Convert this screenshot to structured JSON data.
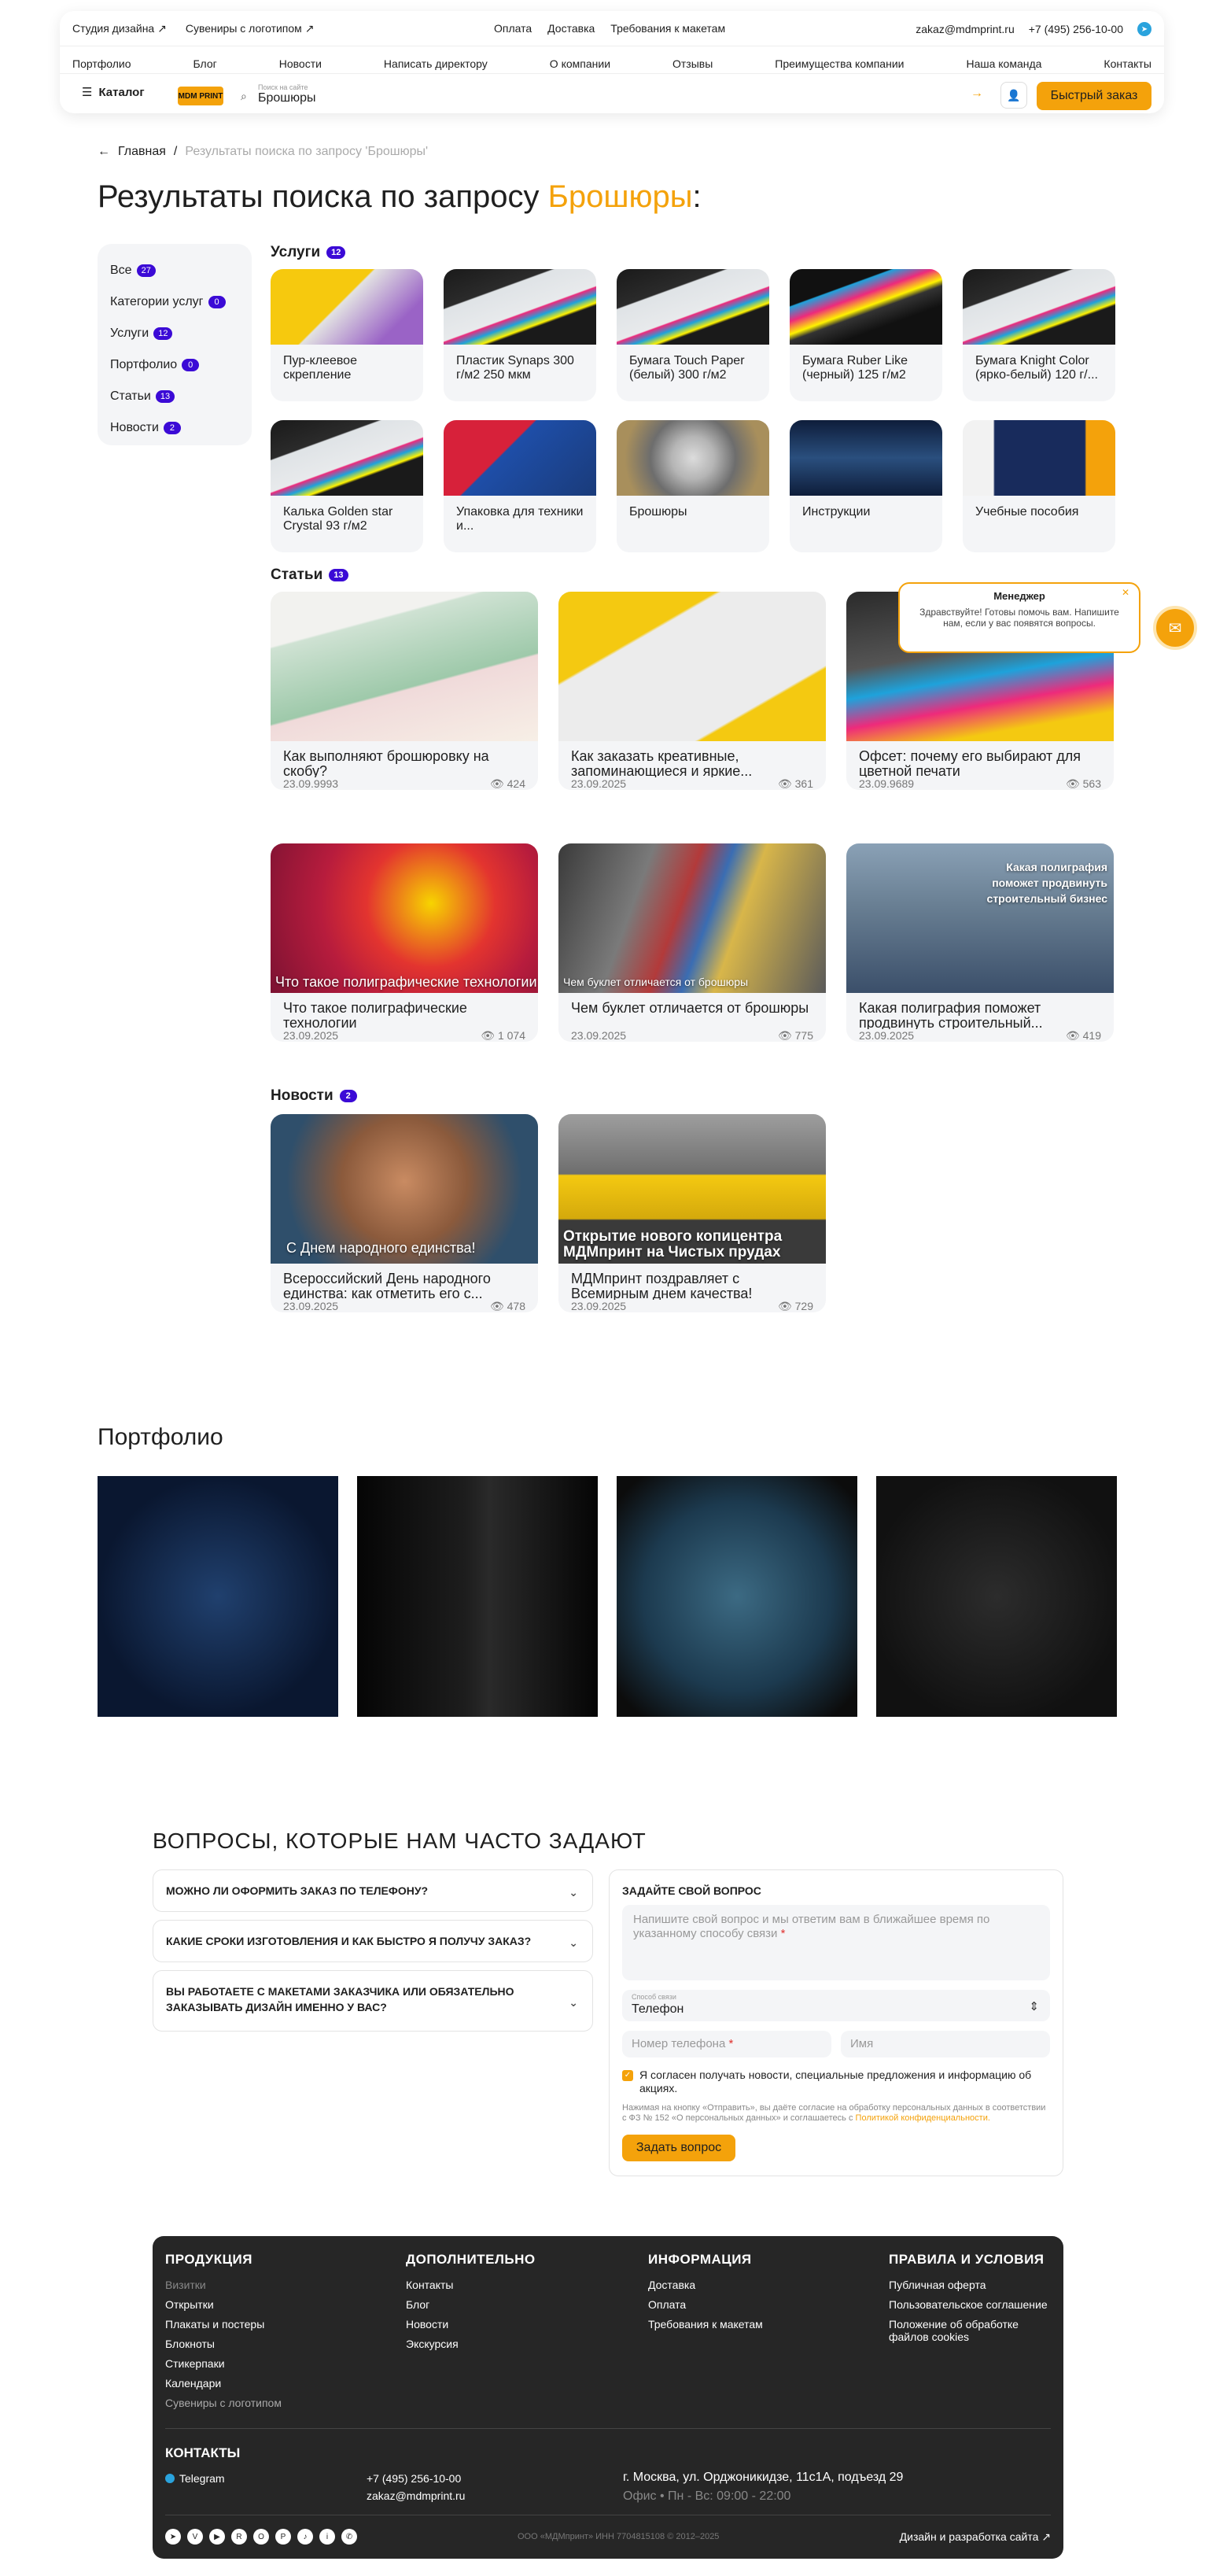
{
  "header": {
    "top_left": [
      "Студия дизайна ↗",
      "Сувениры с логотипом ↗"
    ],
    "top_center": [
      "Оплата",
      "Доставка",
      "Требования к макетам"
    ],
    "email": "zakaz@mdmprint.ru",
    "phone": "+7 (495) 256-10-00",
    "nav": [
      "Портфолио",
      "Блог",
      "Новости",
      "Написать директору",
      "О компании",
      "Отзывы",
      "Преимущества компании",
      "Наша команда",
      "Контакты"
    ],
    "catalog": "Каталог",
    "logo_text": "MDM PRINT",
    "search_placeholder": "Поиск на сайте",
    "search_value": "Брошюры",
    "quick_order": "Быстрый заказ"
  },
  "breadcrumb": {
    "home": "Главная",
    "sep": "/",
    "current": "Результаты поиска по запросу 'Брошюры'"
  },
  "title": {
    "prefix": "Результаты поиска по запросу ",
    "query": "Брошюры",
    "suffix": ":"
  },
  "sidebar": [
    {
      "label": "Все",
      "count": "27"
    },
    {
      "label": "Категории услуг",
      "count": "0"
    },
    {
      "label": "Услуги",
      "count": "12"
    },
    {
      "label": "Портфолио",
      "count": "0"
    },
    {
      "label": "Статьи",
      "count": "13"
    },
    {
      "label": "Новости",
      "count": "2"
    }
  ],
  "services": {
    "title": "Услуги",
    "count": "12",
    "items": [
      {
        "label": "Пур-клеевое скрепление"
      },
      {
        "label": "Пластик Synaps 300 г/м2 250 мкм"
      },
      {
        "label": "Бумага Touch Paper (белый) 300 г/м2"
      },
      {
        "label": "Бумага Ruber Like (черный) 125 г/м2"
      },
      {
        "label": "Бумага Knight Color (ярко-белый) 120 г/..."
      },
      {
        "label": "Калька Golden star Crystal 93 г/м2"
      },
      {
        "label": "Упаковка для техники и..."
      },
      {
        "label": "Брошюры"
      },
      {
        "label": "Инструкции"
      },
      {
        "label": "Учебные пособия"
      }
    ]
  },
  "articles": {
    "title": "Статьи",
    "count": "13",
    "items": [
      {
        "title": "Как выполняют брошюровку на скобу?",
        "date": "23.09.9993",
        "views": "424",
        "overlay": ""
      },
      {
        "title": "Как заказать креативные, запоминающиеся и яркие...",
        "date": "23.09.2025",
        "views": "361",
        "overlay": ""
      },
      {
        "title": "Офсет: почему его выбирают для цветной печати",
        "date": "23.09.9689",
        "views": "563",
        "overlay": ""
      },
      {
        "title": "Что такое полиграфические технологии",
        "date": "23.09.2025",
        "views": "1 074",
        "overlay": "Что такое полиграфические технологии"
      },
      {
        "title": "Чем буклет отличается от брошюры",
        "date": "23.09.2025",
        "views": "775",
        "overlay": "Чем буклет отличается от брошюры"
      },
      {
        "title": "Какая полиграфия поможет продвинуть строительный...",
        "date": "23.09.2025",
        "views": "419",
        "overlay": "Какая полиграфия поможет продвинуть строительный бизнес"
      }
    ]
  },
  "news": {
    "title": "Новости",
    "count": "2",
    "items": [
      {
        "title": "Всероссийский День народного единства: как отметить его с...",
        "date": "23.09.2025",
        "views": "478",
        "overlay": "С Днем народного единства!"
      },
      {
        "title": "МДМпринт поздравляет с Всемирным днем качества!",
        "date": "23.09.2025",
        "views": "729",
        "overlay": "Открытие нового копицентра МДМпринт на Чистых прудах"
      }
    ]
  },
  "portfolio": {
    "title": "Портфолио"
  },
  "chat": {
    "title": "Менеджер",
    "text": "Здравствуйте! Готовы помочь вам. Напишите нам, если у вас появятся вопросы."
  },
  "faq": {
    "title": "ВОПРОСЫ, КОТОРЫЕ НАМ ЧАСТО ЗАДАЮТ",
    "items": [
      "МОЖНО ЛИ ОФОРМИТЬ ЗАКАЗ ПО ТЕЛЕФОНУ?",
      "КАКИЕ СРОКИ ИЗГОТОВЛЕНИЯ И КАК БЫСТРО Я ПОЛУЧУ ЗАКАЗ?",
      "ВЫ РАБОТАЕТЕ С МАКЕТАМИ ЗАКАЗЧИКА ИЛИ ОБЯЗАТЕЛЬНО ЗАКАЗЫВАТЬ ДИЗАЙН ИМЕННО У ВАС?"
    ]
  },
  "form": {
    "title": "ЗАДАЙТЕ СВОЙ ВОПРОС",
    "question_ph": "Напишите свой вопрос и мы ответим вам в ближайшее время по указанному способу связи",
    "contact_label": "Способ связи",
    "contact_value": "Телефон",
    "phone_ph": "Номер телефона",
    "name_ph": "Имя",
    "consent": "Я согласен получать новости, специальные предложения и информацию об акциях.",
    "legal": "Нажимая на кнопку «Отправить», вы даёте согласие на обработку персональных данных в соответствии с ФЗ № 152 «О персональных данных» и соглашаетесь с",
    "policy_link": "Политикой конфиденциальности.",
    "submit": "Задать вопрос"
  },
  "footer": {
    "cols": [
      {
        "title": "ПРОДУКЦИЯ",
        "links": [
          "Визитки",
          "Открытки",
          "Плакаты и постеры",
          "Блокноты",
          "Стикерпаки",
          "Календари",
          "Сувениры с логотипом"
        ]
      },
      {
        "title": "ДОПОЛНИТЕЛЬНО",
        "links": [
          "Контакты",
          "Блог",
          "Новости",
          "Экскурсия"
        ]
      },
      {
        "title": "ИНФОРМАЦИЯ",
        "links": [
          "Доставка",
          "Оплата",
          "Требования к макетам"
        ]
      },
      {
        "title": "ПРАВИЛА И УСЛОВИЯ",
        "links": [
          "Публичная оферта",
          "Пользовательское соглашение",
          "Положение об обработке файлов cookies"
        ]
      }
    ],
    "contacts_title": "КОНТАКТЫ",
    "telegram": "Telegram",
    "phone": "+7 (495) 256-10-00",
    "email": "zakaz@mdmprint.ru",
    "address": "г. Москва, ул. Орджоникидзе, 11с1А, подъезд 29",
    "hours": "Офис • Пн - Вс: 09:00 - 22:00",
    "legal": "ООО «МДМпринт»   ИНН 7704815108   © 2012–2025",
    "design": "Дизайн и разработка сайта ↗"
  },
  "colors": {
    "accent": "#f4a20b",
    "badge": "#3b0ad6",
    "footer_bg": "#262626"
  }
}
